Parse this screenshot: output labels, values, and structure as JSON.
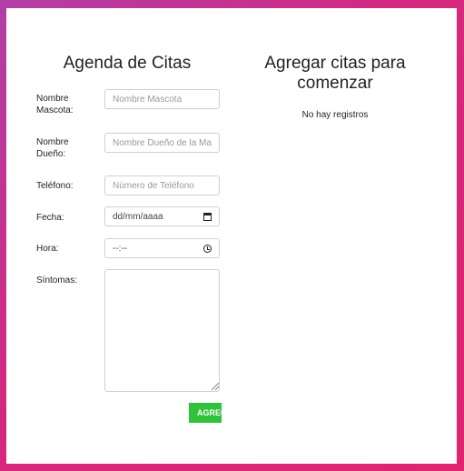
{
  "form": {
    "title": "Agenda de Citas",
    "fields": {
      "pet_name": {
        "label": "Nombre Mascota:",
        "placeholder": "Nombre Mascota",
        "value": ""
      },
      "owner_name": {
        "label": "Nombre Dueño:",
        "placeholder": "Nombre Dueño de la Mascota",
        "value": ""
      },
      "phone": {
        "label": "Teléfono:",
        "placeholder": "Número de Teléfono",
        "value": ""
      },
      "date": {
        "label": "Fecha:",
        "display": "dd/mm/aaaa",
        "icon": "calendar-icon"
      },
      "time": {
        "label": "Hora:",
        "display": "--:--",
        "icon": "clock-icon"
      },
      "symptoms": {
        "label": "Síntomas:",
        "value": ""
      }
    },
    "submit_label": "AGREGAR"
  },
  "appointments": {
    "title": "Agregar citas para comenzar",
    "empty_message": "No hay registros"
  },
  "colors": {
    "background_gradient_start": "#b13fa6",
    "background_gradient_end": "#e0246f",
    "button": "#2fc23a"
  }
}
